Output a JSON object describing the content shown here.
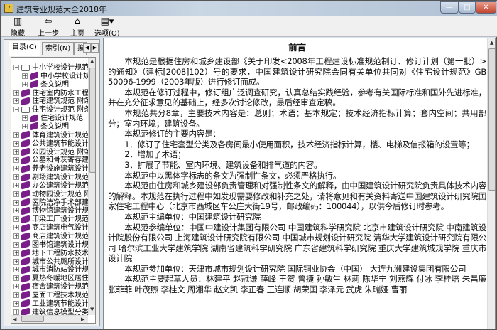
{
  "window": {
    "title": "建筑专业规范大全2018年",
    "minimize": "—",
    "maximize": "□",
    "close": "✕"
  },
  "toolbar": {
    "items": [
      {
        "label": "隐藏",
        "icon": "hide-icon",
        "glyph": "▥"
      },
      {
        "label": "上一步",
        "icon": "back-arrow-icon",
        "glyph": "⇦"
      },
      {
        "label": "主页",
        "icon": "home-icon",
        "glyph": "⌂"
      },
      {
        "label": "选项(O)",
        "icon": "options-icon",
        "glyph": "▤▾"
      }
    ]
  },
  "tabs": [
    {
      "label": "目录(C)"
    },
    {
      "label": "索引(N)"
    },
    {
      "label": "搜"
    }
  ],
  "tree": [
    {
      "label": "中小学校设计规范",
      "level": 0,
      "open": true
    },
    {
      "label": "中小学校设计规",
      "level": 1
    },
    {
      "label": "条文说明",
      "level": 1
    },
    {
      "label": "住宅室内防水工程",
      "level": 0
    },
    {
      "label": "住宅建筑规范 附条",
      "level": 0
    },
    {
      "label": "住宅设计规范 附条",
      "level": 0,
      "open": true
    },
    {
      "label": "住宅设计规范",
      "level": 1
    },
    {
      "label": "条文说明",
      "level": 1
    },
    {
      "label": "体育建筑设计规范",
      "level": 0
    },
    {
      "label": "公共建筑节能设计",
      "level": 0
    },
    {
      "label": "公园设计规范 附条",
      "level": 0
    },
    {
      "label": "公墓和骨灰寄存建",
      "level": 0
    },
    {
      "label": "养老设施建筑设计",
      "level": 0
    },
    {
      "label": "剧场建筑设计规范",
      "level": 0
    },
    {
      "label": "办公建筑设计规范",
      "level": 0
    },
    {
      "label": "动物园设计规范 附",
      "level": 0
    },
    {
      "label": "医院洁净手术部建",
      "level": 0
    },
    {
      "label": "博物馆建筑设计规",
      "level": 0
    },
    {
      "label": "印染工厂设计规范",
      "level": 0
    },
    {
      "label": "商店建筑电气设计",
      "level": 0
    },
    {
      "label": "商店建筑设计规范",
      "level": 0
    },
    {
      "label": "图书馆建筑设计规",
      "level": 0
    },
    {
      "label": "地下工程防水技术",
      "level": 0
    },
    {
      "label": "城市公共厕所设计",
      "level": 0
    },
    {
      "label": "城市消防站设计规",
      "level": 0
    },
    {
      "label": "夏热冬暖地区居住",
      "level": 0
    },
    {
      "label": "宿舍建筑设计规范",
      "level": 0
    },
    {
      "label": "屋面工程技术规范",
      "level": 0
    },
    {
      "label": "工业建筑节能设计",
      "level": 0
    },
    {
      "label": "建筑信息模型分类",
      "level": 0
    }
  ],
  "document": {
    "title": "前言",
    "paragraphs": [
      "本规范是根据住房和城乡建设部《关于印发<2008年工程建设标准规范制订、修订计划（第一批）>的通知》（建标[2008]102）号的要求，中国建筑设计研究院会同有关单位共同对《住宅设计规范》GB 50096-1999（2003年版）进行修订而成。",
      "本规范在修订过程中，修订组广泛调查研究，认真总结实践经验，参考有关国际标准和国外先进标准，并在充分征求意见的基础上，经多次讨论修改，最后经审查定稿。",
      "本规范共分8章，主要技术内容是：总则；术语；基本规定；技术经济指标计算；套内空间；共用部分；室内环境；建筑设备。",
      "本规范修订的主要内容是：",
      "1．修订了住宅套型分类及各房间最小使用面积，技术经济指标计算，楼、电梯及信报箱的设置等；",
      "2．增加了术语；",
      "3．扩展了节能、室内环境、建筑设备和排气道的内容。",
      "本规范中以黑体字标志的条文为强制性条文，必须严格执行。",
      "本规范由住房和城乡建设部负责管理和对强制性条文的解释，由中国建筑设计研究院负责具体技术内容的解释。本规范在执行过程中如发现需要修改和补充之处，请将意见和有关资料寄送中国建筑设计研究院国家住宅工程中心（北京市西城区车公庄大街19号，邮政编码：100044），以供今后修订时参考。",
      "本规范主编单位：中国建筑设计研究院",
      "本规范参编单位：中国中建设计集团有限公司 中国建筑科学研究院 北京市建筑设计研究院 中南建筑设计院股份有限公司 上海建筑设计研究院有限公司 中国城市规划设计研究院 清华大学建筑设计研究院有限公司 哈尔滨工业大学建筑学院 湖南省建筑科学研究院 广东省建筑科学研究院 重庆大学建筑城规学院 重庆市设计院",
      "本规范参加单位：天津市城市规划设计研究院 国际铜业协会（中国） 大连九洲建设集团有限公司",
      "本规范主要起草人员：林建平 赵冠谦 薛峰 王贺 曾捷 孙敏生 林莉 陈华宁 刘燕辉 付冰 李桂培 朱昌廉 张菲菲 叶茂煦 李桂文 周湘华 赵文凯 李正春 王连顺 胡荣国 李泽元 武虎 朱瑞娅 曹丽"
    ]
  }
}
